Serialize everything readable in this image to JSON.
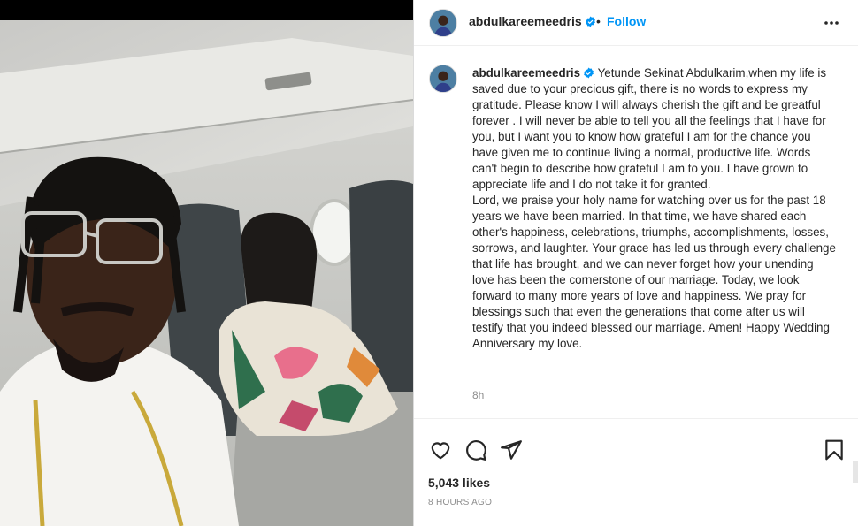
{
  "post": {
    "username": "abdulkareemeedris",
    "separator": "•",
    "follow_label": "Follow",
    "more_icon": "more-horizontal-icon",
    "verified_icon": "verified-badge-icon",
    "caption": {
      "username": "abdulkareemeedris",
      "text": "Yetunde Sekinat Abdulkarim,when my  life is saved due to your  precious gift, there is no  words to express my  gratitude. Please know I will always cherish the gift and be greatful forever . I will never be able to tell you all the feelings that I have for you, but I want you to know how grateful I am for the chance you have given me to continue living a normal, productive life. Words can't begin to describe how grateful I am to you. I have grown to appreciate life and I do not take it for granted.\nLord, we praise your holy name for watching over us for the past 18 years we have been married. In that time, we have shared each other's happiness, celebrations, triumphs, accomplishments, losses, sorrows, and laughter. Your grace has led us through every challenge that life has brought, and we can never forget how your unending love has been the cornerstone of our marriage. Today, we look forward to many more years of love and happiness. We pray for blessings such that even the generations that come after us will testify that you indeed blessed our marriage. Amen! Happy Wedding Anniversary my love.",
      "time": "8h"
    },
    "likes": "5,043 likes",
    "age": "8 HOURS AGO"
  },
  "icons": {
    "like": "heart-icon",
    "comment": "comment-icon",
    "share": "paper-plane-icon",
    "save": "bookmark-icon"
  },
  "colors": {
    "accent": "#0095f6",
    "verified": "#0095f6",
    "text": "#262626",
    "muted": "#8e8e8e",
    "border": "#dbdbdb"
  }
}
